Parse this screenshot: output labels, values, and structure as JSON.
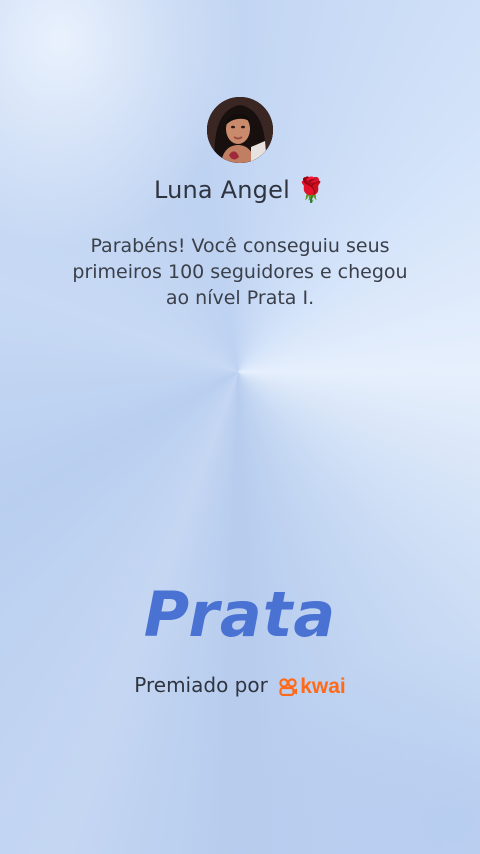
{
  "profile": {
    "name": "Luna Angel",
    "name_emoji": "🌹",
    "avatar_icon": "profile-photo"
  },
  "message": "Parabéns! Você conseguiu seus primeiros 100 seguidores e chegou ao nível Prata I.",
  "level": {
    "label": "Prata",
    "color": "#4a72d3"
  },
  "footer": {
    "awarded_by": "Premiado por",
    "brand_name": "kwai",
    "brand_color": "#ff6a1a",
    "brand_icon": "kwai-logo-icon"
  },
  "colors": {
    "background": "#c4d6f2",
    "text": "#2f3440"
  }
}
